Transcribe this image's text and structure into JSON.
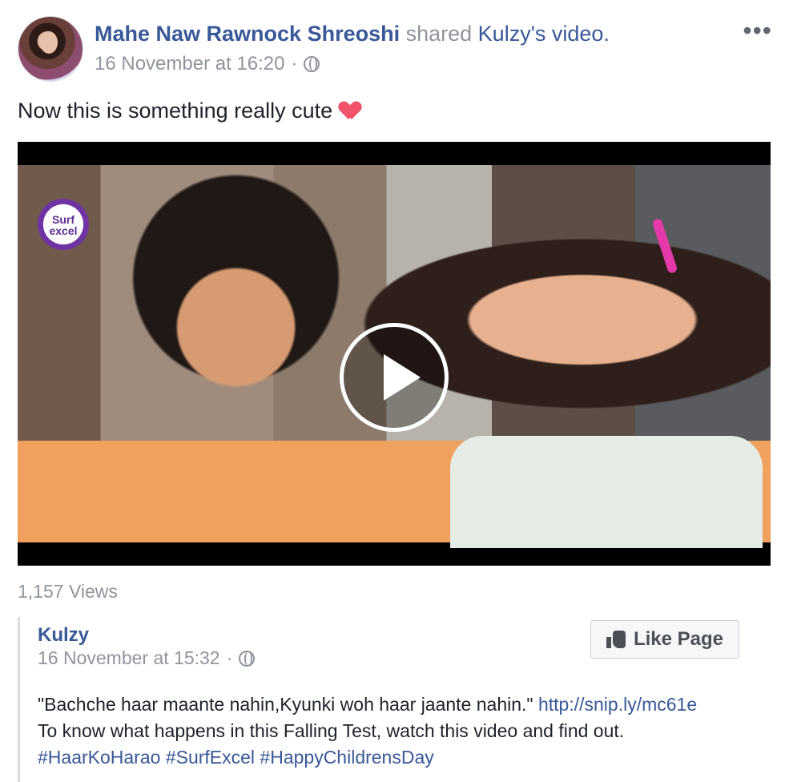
{
  "post": {
    "author": "Mahe Naw Rawnock Shreoshi",
    "shared_text": " shared ",
    "shared_page": "Kulzy",
    "shared_suffix": "'s video.",
    "timestamp": "16 November at 16:20",
    "caption": "Now this is something really cute",
    "views": "1,157 Views"
  },
  "video": {
    "logo_text_1": "Surf",
    "logo_text_2": "excel"
  },
  "shared_post": {
    "page_name": "Kulzy",
    "timestamp": "16 November at 15:32",
    "like_button": "Like Page",
    "quote": "\"Bachche haar maante nahin,Kyunki woh haar jaante nahin.\"",
    "link": "http://snip.ly/mc61e",
    "line2": "To know what happens in this Falling Test, watch this video and find out.",
    "hashtags": [
      "#HaarKoHarao",
      "#SurfExcel",
      "#HappyChildrensDay"
    ]
  },
  "icons": {
    "globe": "globe-icon",
    "more": "more-options-icon",
    "heart": "heart-icon",
    "thumb": "thumbs-up-icon",
    "play": "play-icon"
  }
}
